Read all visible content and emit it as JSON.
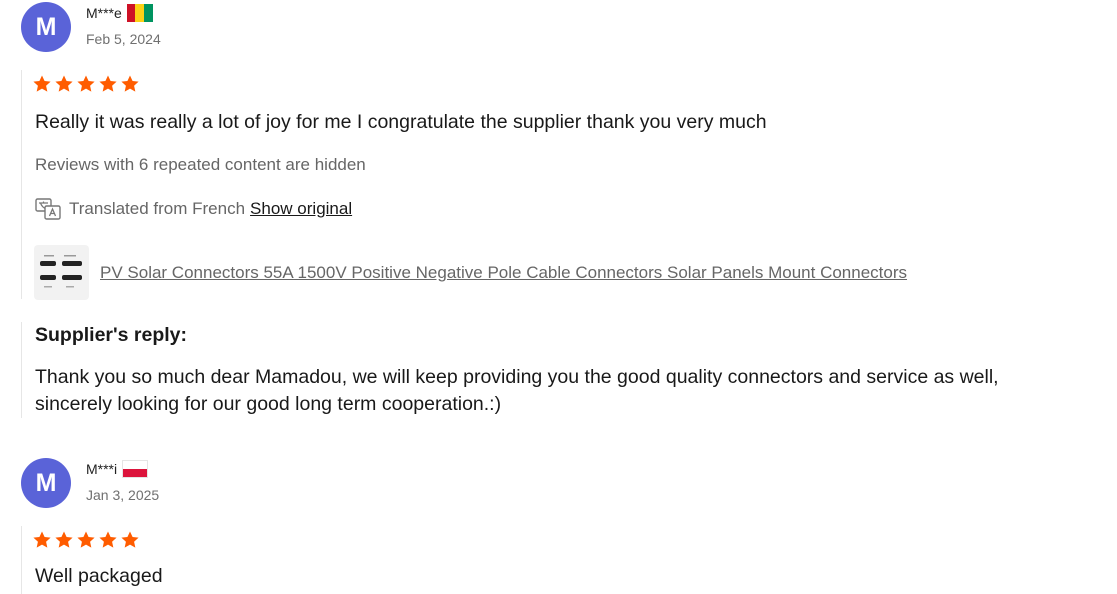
{
  "reviews": [
    {
      "avatar_letter": "M",
      "name": "M***e",
      "flag": "guinea-flag",
      "date": "Feb 5, 2024",
      "rating": 5,
      "text": "Really it was really a lot of joy for me I congratulate the supplier thank you very much",
      "hidden_note": "Reviews with 6 repeated content are hidden",
      "translated_label": "Translated from French",
      "show_original_label": "Show original",
      "product_title": "PV Solar Connectors 55A 1500V Positive Negative Pole Cable Connectors Solar Panels Mount Connectors",
      "supplier_reply_title": "Supplier's reply:",
      "supplier_reply_text": "Thank you so much dear Mamadou, we will keep providing you the good quality connectors and service as well, sincerely looking for our good long term cooperation.:)"
    },
    {
      "avatar_letter": "M",
      "name": "M***i",
      "flag": "poland-flag",
      "date": "Jan 3, 2025",
      "rating": 5,
      "text": "Well packaged"
    }
  ],
  "colors": {
    "avatar": "#5a63d8",
    "star": "#ff5c00",
    "link": "#191919",
    "muted": "#666666"
  }
}
